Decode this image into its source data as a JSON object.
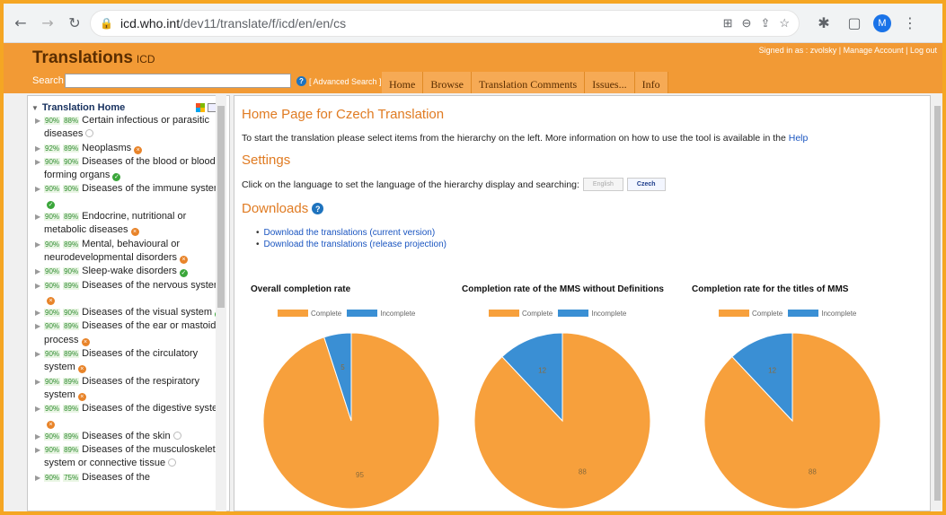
{
  "browser": {
    "url_domain": "icd.who.int",
    "url_path": "/dev11/translate/f/icd/en/en/cs",
    "profile_initial": "M"
  },
  "header": {
    "title": "Translations",
    "subtitle": "ICD",
    "signed_in": "Signed in as : zvolsky",
    "manage_account": "Manage Account",
    "logout": "Log out"
  },
  "search": {
    "label": "Search",
    "value": "",
    "advanced": "[ Advanced Search ]"
  },
  "tabs": [
    "Home",
    "Browse",
    "Translation Comments",
    "Issues...",
    "Info"
  ],
  "tree": {
    "root": "Translation Home",
    "items": [
      {
        "p1": "90%",
        "p2": "88%",
        "label": "Certain infectious or parasitic diseases",
        "status": "empty"
      },
      {
        "p1": "92%",
        "p2": "89%",
        "label": "Neoplasms",
        "status": "x"
      },
      {
        "p1": "90%",
        "p2": "90%",
        "label": "Diseases of the blood or blood-forming organs",
        "status": "ok"
      },
      {
        "p1": "90%",
        "p2": "90%",
        "label": "Diseases of the immune system",
        "status": "ok"
      },
      {
        "p1": "90%",
        "p2": "89%",
        "label": "Endocrine, nutritional or metabolic diseases",
        "status": "x"
      },
      {
        "p1": "90%",
        "p2": "89%",
        "label": "Mental, behavioural or neurodevelopmental disorders",
        "status": "x"
      },
      {
        "p1": "90%",
        "p2": "90%",
        "label": "Sleep-wake disorders",
        "status": "ok"
      },
      {
        "p1": "90%",
        "p2": "89%",
        "label": "Diseases of the nervous system",
        "status": "x"
      },
      {
        "p1": "90%",
        "p2": "90%",
        "label": "Diseases of the visual system",
        "status": "ok"
      },
      {
        "p1": "90%",
        "p2": "89%",
        "label": "Diseases of the ear or mastoid process",
        "status": "x"
      },
      {
        "p1": "90%",
        "p2": "89%",
        "label": "Diseases of the circulatory system",
        "status": "x"
      },
      {
        "p1": "90%",
        "p2": "89%",
        "label": "Diseases of the respiratory system",
        "status": "x"
      },
      {
        "p1": "90%",
        "p2": "89%",
        "label": "Diseases of the digestive system",
        "status": "x"
      },
      {
        "p1": "90%",
        "p2": "89%",
        "label": "Diseases of the skin",
        "status": "empty"
      },
      {
        "p1": "90%",
        "p2": "89%",
        "label": "Diseases of the musculoskeletal system or connective tissue",
        "status": "empty"
      },
      {
        "p1": "90%",
        "p2": "75%",
        "label": "Diseases of the",
        "status": "none"
      }
    ]
  },
  "content": {
    "home_title": "Home Page for Czech Translation",
    "intro": "To start the translation please select items from the hierarchy on the left. More information on how to use the tool is available in the",
    "help_link": "Help",
    "settings_title": "Settings",
    "language_prompt": "Click on the language to set the language of the hierarchy display and searching:",
    "lang_english": "English",
    "lang_czech": "Czech",
    "downloads_title": "Downloads",
    "downloads": [
      "Download the translations (current version)",
      "Download the translations (release projection)"
    ]
  },
  "colors": {
    "complete": "#f7a03c",
    "incomplete": "#3a8fd4"
  },
  "chart_data": [
    {
      "type": "pie",
      "title": "Overall completion rate",
      "legend": [
        "Complete",
        "Incomplete"
      ],
      "values": [
        95,
        5
      ]
    },
    {
      "type": "pie",
      "title": "Completion rate of the MMS without Definitions",
      "legend": [
        "Complete",
        "Incomplete"
      ],
      "values": [
        88,
        12
      ]
    },
    {
      "type": "pie",
      "title": "Completion rate for the titles of MMS",
      "legend": [
        "Complete",
        "Incomplete"
      ],
      "values": [
        88,
        12
      ]
    }
  ]
}
